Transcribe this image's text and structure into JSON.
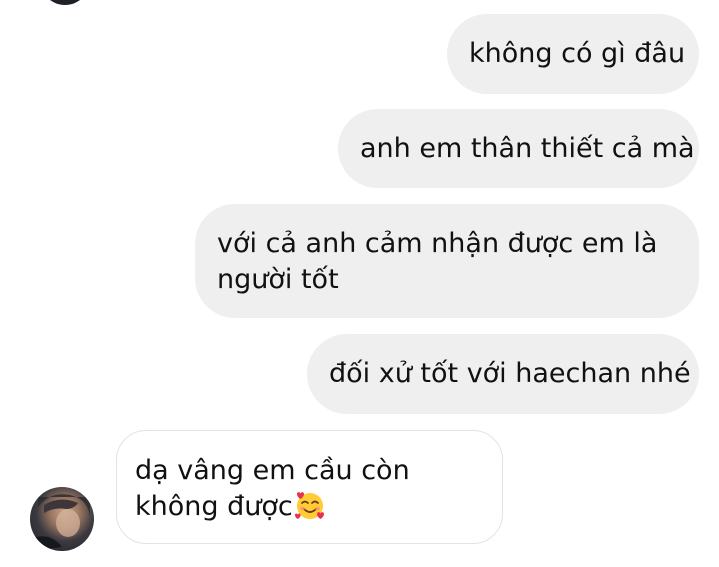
{
  "conversation": {
    "messages": [
      {
        "sender": "me",
        "text": "không có gì đâu"
      },
      {
        "sender": "me",
        "text": "anh em thân thiết cả mà"
      },
      {
        "sender": "me",
        "line1": "với cả anh cảm nhận được em là",
        "line2": "người tốt"
      },
      {
        "sender": "me",
        "text": "đối xử tốt với haechan nhé"
      },
      {
        "sender": "them",
        "line1": "dạ vâng em cầu còn",
        "line2": "không được",
        "emoji": "smiling-face-with-hearts"
      }
    ]
  },
  "colors": {
    "sent_bubble": "#efefef",
    "received_border": "#e3e3e3",
    "text": "#111111"
  }
}
